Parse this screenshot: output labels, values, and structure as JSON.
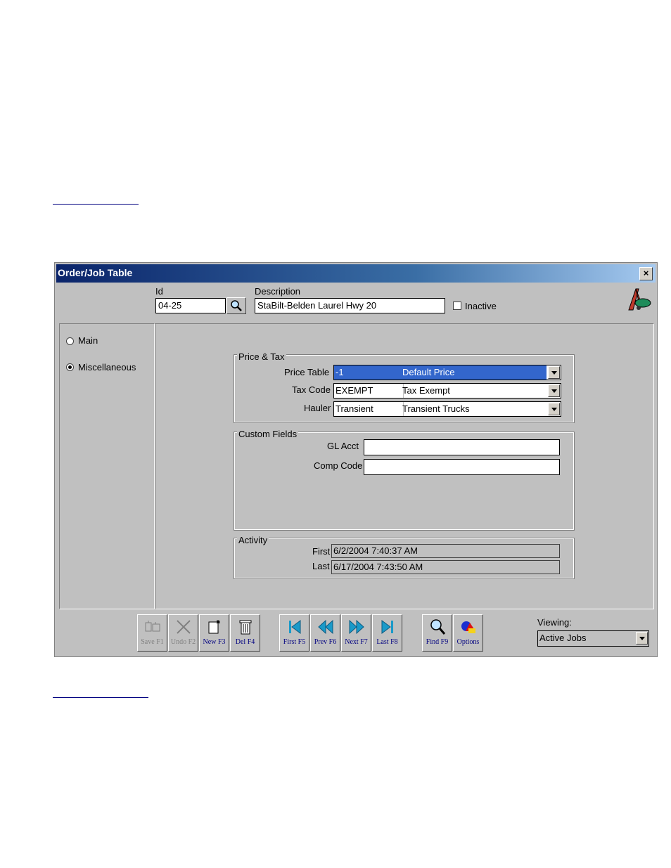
{
  "window": {
    "title": "Order/Job Table",
    "close_glyph": "×"
  },
  "header": {
    "id_label": "Id",
    "id_value": "04-25",
    "description_label": "Description",
    "description_value": "StaBilt-Belden Laurel Hwy 20",
    "inactive_label": "Inactive",
    "inactive_checked": false
  },
  "nav": {
    "main": "Main",
    "miscellaneous": "Miscellaneous",
    "selected": "Miscellaneous"
  },
  "price_tax": {
    "group_label": "Price & Tax",
    "price_table_label": "Price Table",
    "price_table_code": "-1",
    "price_table_name": "Default Price",
    "tax_code_label": "Tax Code",
    "tax_code_code": "EXEMPT",
    "tax_code_name": "Tax Exempt",
    "hauler_label": "Hauler",
    "hauler_code": "Transient",
    "hauler_name": "Transient Trucks"
  },
  "custom_fields": {
    "group_label": "Custom Fields",
    "gl_acct_label": "GL Acct",
    "gl_acct_value": "",
    "comp_code_label": "Comp Code",
    "comp_code_value": ""
  },
  "activity": {
    "group_label": "Activity",
    "first_label": "First",
    "first_value": "6/2/2004 7:40:37 AM",
    "last_label": "Last",
    "last_value": "6/17/2004 7:43:50 AM"
  },
  "toolbar": {
    "save": "Save F1",
    "undo": "Undo F2",
    "new": "New F3",
    "del": "Del F4",
    "first": "First F5",
    "prev": "Prev F6",
    "next": "Next F7",
    "last": "Last F8",
    "find": "Find F9",
    "options": "Options"
  },
  "viewing": {
    "label": "Viewing:",
    "value": "Active Jobs"
  },
  "colors": {
    "title_bar": "#0a246a",
    "selection": "#3366cc",
    "button_text": "#000080"
  },
  "icons": [
    "search-icon",
    "app-logo-icon",
    "save-icon",
    "undo-icon",
    "new-icon",
    "delete-icon",
    "first-icon",
    "prev-icon",
    "next-icon",
    "last-icon",
    "find-icon",
    "options-icon",
    "dropdown-arrow-icon",
    "close-icon"
  ]
}
